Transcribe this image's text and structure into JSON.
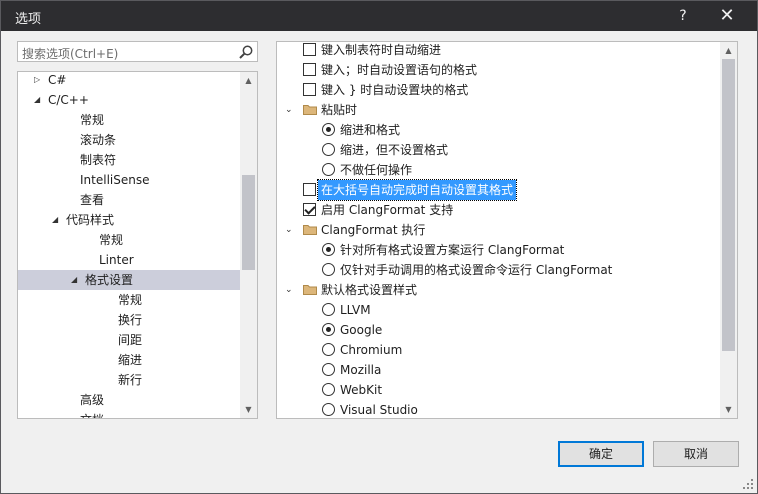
{
  "window": {
    "title": "选项",
    "help": "?",
    "close": "✕"
  },
  "search": {
    "placeholder": "搜索选项(Ctrl+E)"
  },
  "tree": {
    "items": [
      {
        "label": "C#",
        "expander": "collapsed"
      },
      {
        "label": "C/C++",
        "expander": "expanded"
      },
      {
        "label": "常规",
        "expander": "none"
      },
      {
        "label": "滚动条",
        "expander": "none"
      },
      {
        "label": "制表符",
        "expander": "none"
      },
      {
        "label": "IntelliSense",
        "expander": "none"
      },
      {
        "label": "查看",
        "expander": "none"
      },
      {
        "label": "代码样式",
        "expander": "expanded"
      },
      {
        "label": "常规",
        "expander": "none"
      },
      {
        "label": "Linter",
        "expander": "none"
      },
      {
        "label": "格式设置",
        "expander": "expanded",
        "selected": true
      },
      {
        "label": "常规",
        "expander": "none"
      },
      {
        "label": "换行",
        "expander": "none"
      },
      {
        "label": "间距",
        "expander": "none"
      },
      {
        "label": "缩进",
        "expander": "none"
      },
      {
        "label": "新行",
        "expander": "none"
      },
      {
        "label": "高级",
        "expander": "none"
      },
      {
        "label": "文档",
        "expander": "none"
      }
    ]
  },
  "options": {
    "rows": [
      {
        "kind": "checkbox",
        "checked": false,
        "label": "键入制表符时自动缩进"
      },
      {
        "kind": "checkbox",
        "checked": false,
        "label": "键入；时自动设置语句的格式"
      },
      {
        "kind": "checkbox",
        "checked": false,
        "label": "键入 } 时自动设置块的格式"
      },
      {
        "kind": "group",
        "label": "粘贴时"
      },
      {
        "kind": "radio",
        "checked": true,
        "label": "缩进和格式"
      },
      {
        "kind": "radio",
        "checked": false,
        "label": "缩进，但不设置格式"
      },
      {
        "kind": "radio",
        "checked": false,
        "label": "不做任何操作"
      },
      {
        "kind": "checkbox",
        "checked": false,
        "label": "在大括号自动完成时自动设置其格式",
        "highlight": true
      },
      {
        "kind": "checkbox",
        "checked": true,
        "label": "启用 ClangFormat 支持"
      },
      {
        "kind": "group",
        "label": "ClangFormat 执行"
      },
      {
        "kind": "radio",
        "checked": true,
        "label": "针对所有格式设置方案运行 ClangFormat"
      },
      {
        "kind": "radio",
        "checked": false,
        "label": "仅针对手动调用的格式设置命令运行 ClangFormat"
      },
      {
        "kind": "group",
        "label": "默认格式设置样式"
      },
      {
        "kind": "radio",
        "checked": false,
        "label": "LLVM"
      },
      {
        "kind": "radio",
        "checked": true,
        "label": "Google"
      },
      {
        "kind": "radio",
        "checked": false,
        "label": "Chromium"
      },
      {
        "kind": "radio",
        "checked": false,
        "label": "Mozilla"
      },
      {
        "kind": "radio",
        "checked": false,
        "label": "WebKit"
      },
      {
        "kind": "radio",
        "checked": false,
        "label": "Visual Studio"
      }
    ]
  },
  "buttons": {
    "ok": "确定",
    "cancel": "取消"
  },
  "colors": {
    "selection": "#cccedb",
    "highlight": "#3399ff",
    "primary_border": "#0078d7"
  }
}
